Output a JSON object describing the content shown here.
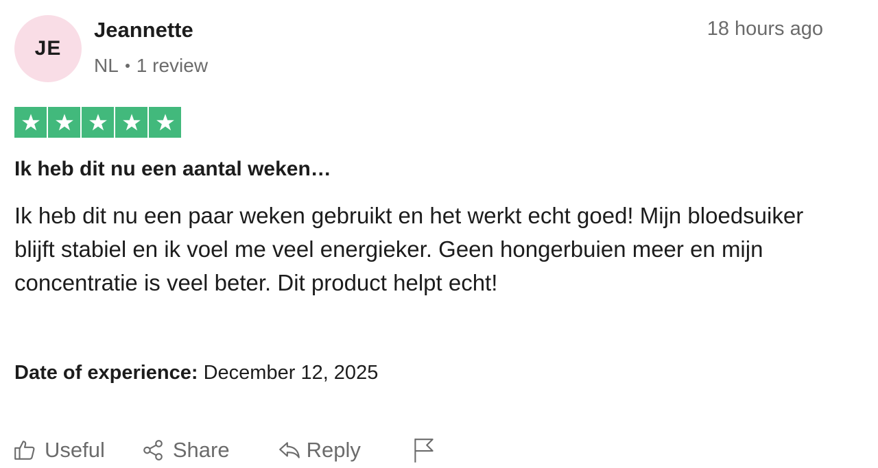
{
  "reviewer": {
    "initials": "JE",
    "name": "Jeannette",
    "country": "NL",
    "review_count": "1 review",
    "avatar_color": "#f9dde6"
  },
  "timestamp": "18 hours ago",
  "rating": {
    "stars": 5,
    "max": 5,
    "color": "#42b97c"
  },
  "review": {
    "title": "Ik heb dit nu een aantal weken…",
    "body": "Ik heb dit nu een paar weken gebruikt en het werkt echt goed! Mijn bloedsuiker blijft stabiel en ik voel me veel energieker. Geen hongerbuien meer en mijn concentratie is veel beter. Dit product helpt echt!"
  },
  "experience": {
    "label": "Date of experience:",
    "date": "December 12, 2025"
  },
  "actions": {
    "useful_label": "Useful",
    "share_label": "Share",
    "reply_label": "Reply",
    "icons": [
      "thumbs-up-icon",
      "share-icon",
      "reply-icon",
      "flag-icon"
    ]
  }
}
